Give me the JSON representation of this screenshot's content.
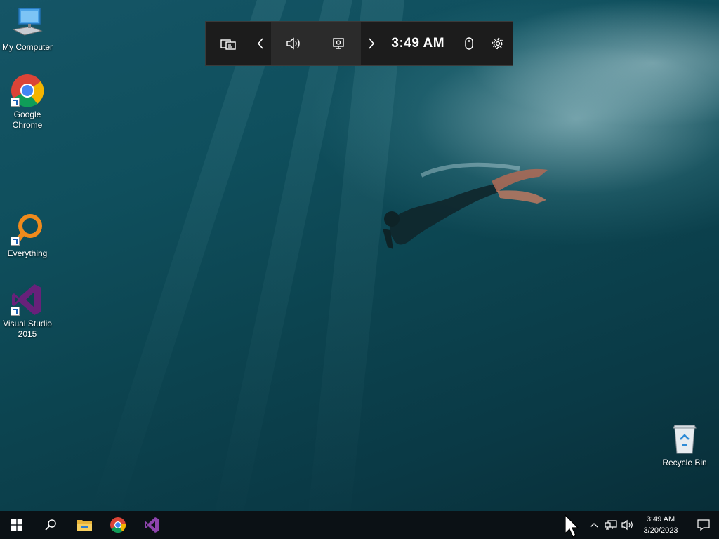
{
  "desktop": {
    "icons": [
      {
        "label": "My Computer"
      },
      {
        "label": "Google Chrome"
      },
      {
        "label": "Everything"
      },
      {
        "label": "Visual Studio 2015"
      },
      {
        "label": "Recycle Bin"
      }
    ]
  },
  "gamebar": {
    "time": "3:49 AM",
    "icons": [
      "widget-menu-icon",
      "chevron-left-icon",
      "volume-icon",
      "capture-icon",
      "chevron-right-icon",
      "mouse-icon",
      "gear-icon"
    ]
  },
  "taskbar": {
    "apps": [
      "start-icon",
      "search-icon",
      "file-explorer-icon",
      "chrome-icon",
      "visual-studio-icon"
    ],
    "tray": {
      "time": "3:49 AM",
      "date": "3/20/2023"
    }
  },
  "colors": {
    "taskbar": "#0b1115",
    "gamebar": "#1c1c1c",
    "vs_purple": "#68217a"
  }
}
